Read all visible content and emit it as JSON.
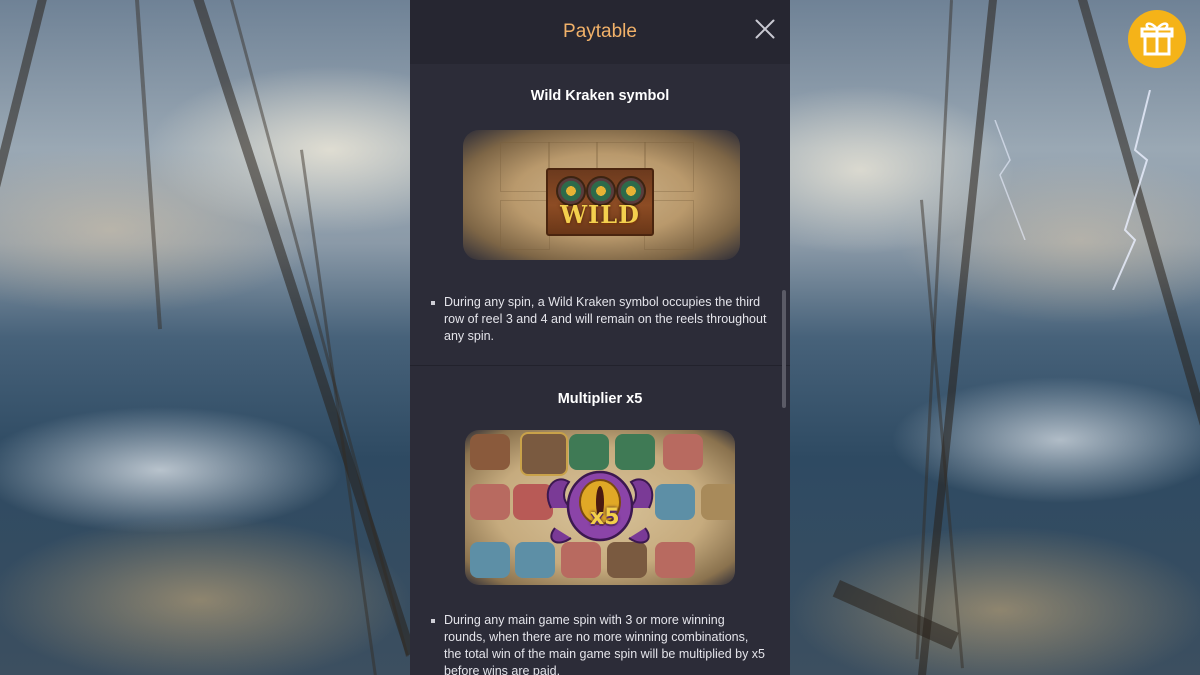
{
  "modal": {
    "title": "Paytable",
    "close_icon": "close-icon"
  },
  "sections": [
    {
      "title": "Wild Kraken symbol",
      "image_label": "WILD",
      "bullets": [
        "During any spin, a Wild Kraken symbol occupies the third row of reel 3 and 4 and will remain on the reels throughout any spin."
      ]
    },
    {
      "title": "Multiplier x5",
      "image_label": "x5",
      "bullets": [
        "During any main game spin with 3 or more winning rounds, when there are no more winning combinations, the total win of the main game spin will be multiplied by x5 before wins are paid."
      ]
    }
  ],
  "gift_button": {
    "icon": "gift-icon",
    "color": "#f5b318"
  },
  "colors": {
    "title_accent": "#f1b169",
    "panel_bg": "#2c2c38",
    "header_bg": "#262631"
  }
}
